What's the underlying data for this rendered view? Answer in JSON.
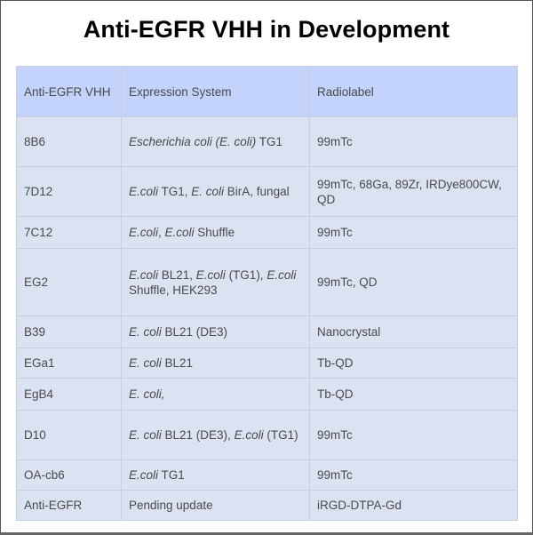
{
  "title": "Anti-EGFR VHH in Development",
  "table": {
    "headers": [
      "Anti-EGFR VHH",
      "Expression System",
      "Radiolabel"
    ],
    "rows": [
      {
        "vhh": "8B6",
        "expression": [
          {
            "t": "Escherichia coli (E. coli)",
            "i": true
          },
          {
            "t": " TG1",
            "i": false
          }
        ],
        "radiolabel": "99mTc"
      },
      {
        "vhh": "7D12",
        "expression": [
          {
            "t": "E.coli",
            "i": true
          },
          {
            "t": " TG1, ",
            "i": false
          },
          {
            "t": "E. coli",
            "i": true
          },
          {
            "t": " BirA, fungal",
            "i": false
          }
        ],
        "radiolabel": "99mTc, 68Ga, 89Zr, IRDye800CW, QD"
      },
      {
        "vhh": "7C12",
        "expression": [
          {
            "t": "E.coli",
            "i": true
          },
          {
            "t": ", ",
            "i": false
          },
          {
            "t": "E.coli",
            "i": true
          },
          {
            "t": " Shuffle",
            "i": false
          }
        ],
        "radiolabel": "99mTc"
      },
      {
        "vhh": "EG2",
        "expression": [
          {
            "t": "E.coli",
            "i": true
          },
          {
            "t": " BL21, ",
            "i": false
          },
          {
            "t": "E.coli",
            "i": true
          },
          {
            "t": " (TG1), ",
            "i": false
          },
          {
            "t": "E.coli",
            "i": true
          },
          {
            "t": " Shuffle, HEK293",
            "i": false
          }
        ],
        "radiolabel": "99mTc, QD"
      },
      {
        "vhh": "B39",
        "expression": [
          {
            "t": "E. coli",
            "i": true
          },
          {
            "t": " BL21 (DE3)",
            "i": false
          }
        ],
        "radiolabel": "Nanocrystal"
      },
      {
        "vhh": "EGa1",
        "expression": [
          {
            "t": "E. coli",
            "i": true
          },
          {
            "t": " BL21",
            "i": false
          }
        ],
        "radiolabel": "Tb-QD"
      },
      {
        "vhh": "EgB4",
        "expression": [
          {
            "t": "E. coli,",
            "i": true
          }
        ],
        "radiolabel": "Tb-QD"
      },
      {
        "vhh": "D10",
        "expression": [
          {
            "t": "E. coli",
            "i": true
          },
          {
            "t": " BL21 (DE3), ",
            "i": false
          },
          {
            "t": "E.coli",
            "i": true
          },
          {
            "t": " (TG1)",
            "i": false
          }
        ],
        "radiolabel": "99mTc"
      },
      {
        "vhh": "OA-cb6",
        "expression": [
          {
            "t": "E.coli",
            "i": true
          },
          {
            "t": " TG1",
            "i": false
          }
        ],
        "radiolabel": "99mTc"
      },
      {
        "vhh": "Anti-EGFR",
        "expression": [
          {
            "t": "Pending update",
            "i": false
          }
        ],
        "radiolabel": "iRGD-DTPA-Gd"
      }
    ]
  }
}
